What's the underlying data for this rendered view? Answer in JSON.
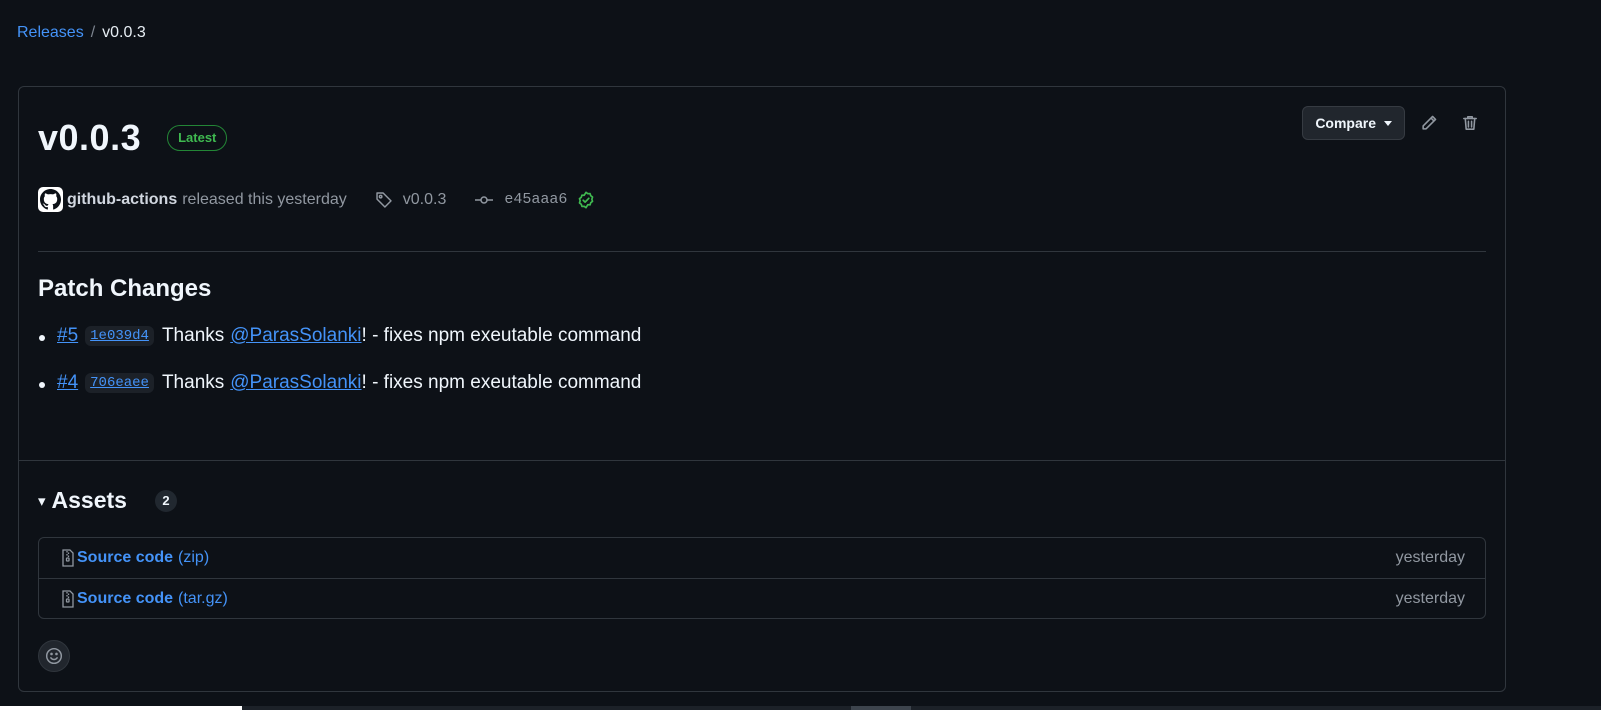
{
  "breadcrumb": {
    "releases_link": "Releases",
    "separator": "/",
    "current": "v0.0.3"
  },
  "release": {
    "title": "v0.0.3",
    "badge": "Latest",
    "compare_label": "Compare",
    "author": "github-actions",
    "released_text": "released this yesterday",
    "tag": "v0.0.3",
    "commit": "e45aaa6"
  },
  "notes": {
    "heading": "Patch Changes",
    "items": [
      {
        "pr": "#5",
        "commit": "1e039d4",
        "thanks": "Thanks",
        "user": "@ParasSolanki",
        "text": "! - fixes npm exeutable command"
      },
      {
        "pr": "#4",
        "commit": "706eaee",
        "thanks": "Thanks",
        "user": "@ParasSolanki",
        "text": "! - fixes npm exeutable command"
      }
    ]
  },
  "assets": {
    "toggle": "▾",
    "title": "Assets",
    "count": "2",
    "items": [
      {
        "name": "Source code",
        "ext": "(zip)",
        "date": "yesterday"
      },
      {
        "name": "Source code",
        "ext": "(tar.gz)",
        "date": "yesterday"
      }
    ]
  },
  "icons": {
    "edit": "pencil-icon",
    "delete": "trash-icon",
    "tag": "tag-icon",
    "commit": "git-commit-icon",
    "verified": "check-circle-icon",
    "asset": "file-zip-icon",
    "reaction": "smiley-icon"
  },
  "colors": {
    "background": "#0d1117",
    "link": "#4493f8",
    "success": "#3fb950",
    "border": "#30363d"
  }
}
